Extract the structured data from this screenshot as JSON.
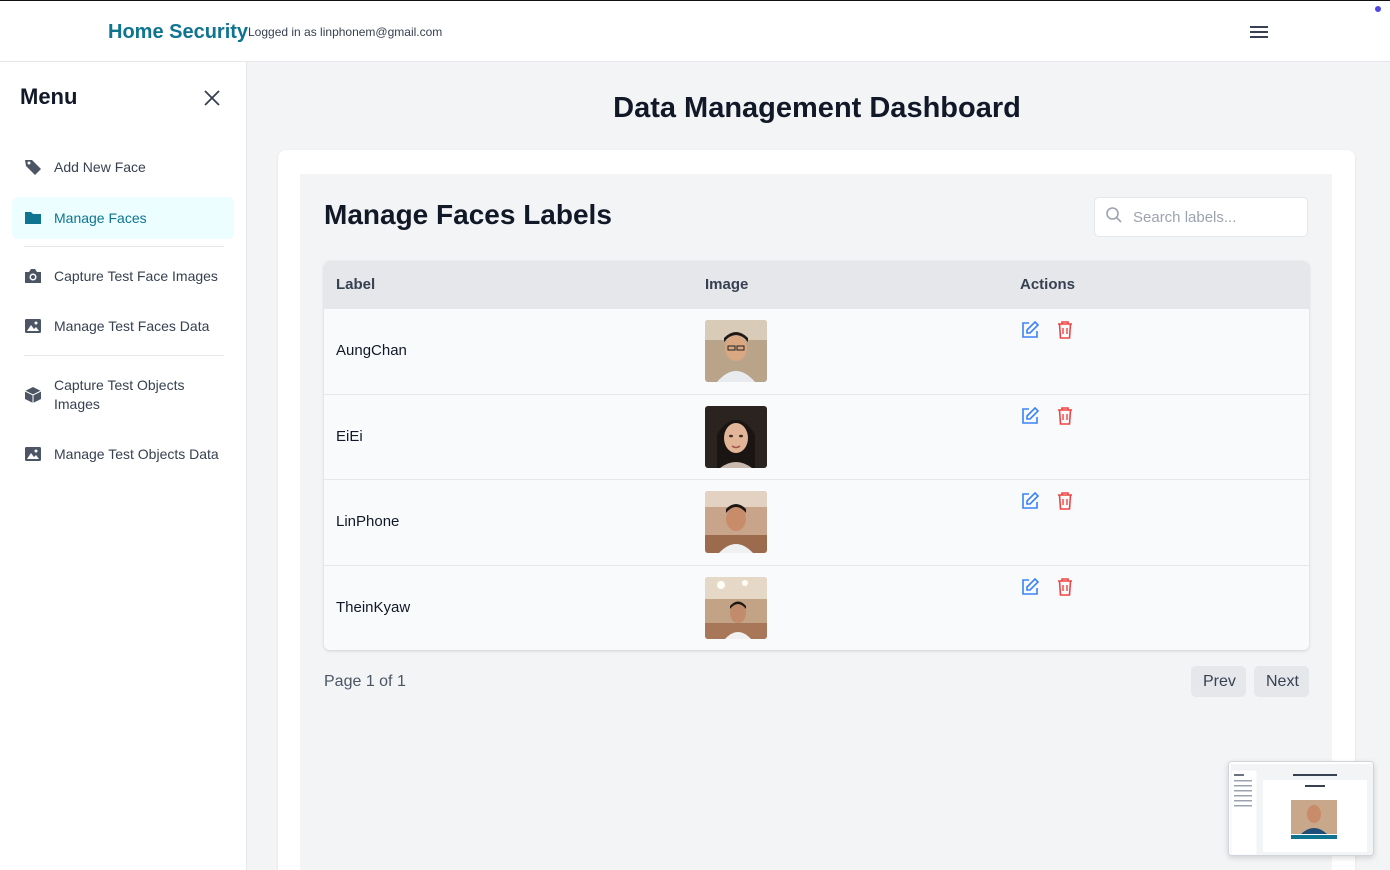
{
  "header": {
    "brand": "Home Security",
    "login_text": "Logged in as linphonem@gmail.com"
  },
  "sidebar": {
    "title": "Menu",
    "items": [
      {
        "label": "Add New Face",
        "icon": "tag-icon",
        "active": false
      },
      {
        "label": "Manage Faces",
        "icon": "folder-icon",
        "active": true
      },
      {
        "label": "Capture Test Face Images",
        "icon": "camera-icon",
        "active": false
      },
      {
        "label": "Manage Test Faces Data",
        "icon": "image-icon",
        "active": false
      },
      {
        "label": "Capture Test Objects Images",
        "icon": "cube-icon",
        "active": false
      },
      {
        "label": "Manage Test Objects Data",
        "icon": "image-icon",
        "active": false
      }
    ]
  },
  "main": {
    "title": "Data Management Dashboard",
    "section_title": "Manage Faces Labels",
    "search": {
      "placeholder": "Search labels...",
      "value": ""
    },
    "table": {
      "columns": [
        "Label",
        "Image",
        "Actions"
      ],
      "rows": [
        {
          "label": "AungChan"
        },
        {
          "label": "EiEi"
        },
        {
          "label": "LinPhone"
        },
        {
          "label": "TheinKyaw"
        }
      ]
    },
    "pagination": {
      "info": "Page 1 of 1",
      "prev_label": "Prev",
      "next_label": "Next"
    }
  },
  "colors": {
    "brand": "#0e7490",
    "active_bg": "#ecfeff",
    "edit": "#3b82f6",
    "delete": "#ef4444"
  }
}
